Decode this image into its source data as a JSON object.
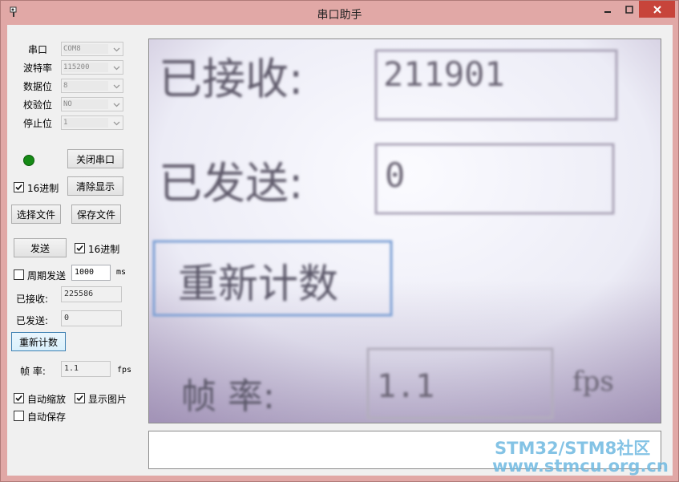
{
  "window": {
    "title": "串口助手"
  },
  "serial": {
    "port": {
      "label": "串口",
      "value": "COM8"
    },
    "baud": {
      "label": "波特率",
      "value": "115200"
    },
    "databits": {
      "label": "数据位",
      "value": "8"
    },
    "parity": {
      "label": "校验位",
      "value": "NO"
    },
    "stopbits": {
      "label": "停止位",
      "value": "1"
    }
  },
  "buttons": {
    "close_port": "关闭串口",
    "clear_display": "清除显示",
    "select_file": "选择文件",
    "save_file": "保存文件",
    "send": "发送",
    "reset_count": "重新计数"
  },
  "receive": {
    "hex_label": "16进制",
    "hex_checked": true
  },
  "send": {
    "hex_label": "16进制",
    "hex_checked": true
  },
  "periodic": {
    "label": "周期发送",
    "checked": false,
    "value": "1000",
    "unit": "ms"
  },
  "counters": {
    "received_label": "已接收:",
    "received_value": "225586",
    "sent_label": "已发送:",
    "sent_value": "0"
  },
  "framerate": {
    "label": "帧 率:",
    "value": "1.1",
    "unit": "fps"
  },
  "options": {
    "auto_scale": {
      "label": "自动缩放",
      "checked": true
    },
    "show_image": {
      "label": "显示图片",
      "checked": true
    },
    "auto_save": {
      "label": "自动保存",
      "checked": false
    }
  },
  "camera_image": {
    "received_label": "已接收:",
    "received_value": "211901",
    "sent_label": "已发送:",
    "sent_value": "0",
    "reset_label": "重新计数",
    "fps_label": "帧 率:",
    "fps_value": "1.1",
    "fps_unit": "fps"
  },
  "watermark": {
    "line1": "STM32/STM8社区",
    "line2": "www.stmcu.org.cn"
  },
  "colors": {
    "led": "#158a15",
    "watermark": "#6eb9e1",
    "close": "#c7443a"
  }
}
